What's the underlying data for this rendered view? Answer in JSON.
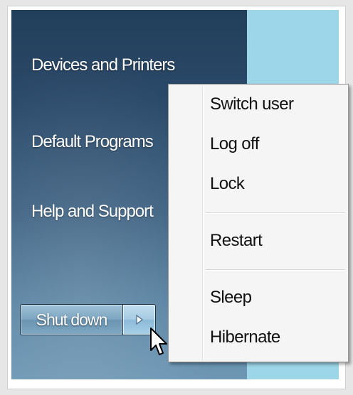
{
  "start_menu": {
    "right_pane": {
      "items": [
        {
          "label": "Devices and Printers"
        },
        {
          "label": "Default Programs"
        },
        {
          "label": "Help and Support"
        }
      ]
    },
    "shutdown": {
      "label": "Shut down",
      "arrow_icon": "triangle-right-icon"
    }
  },
  "power_menu": {
    "groups": [
      [
        {
          "label": "Switch user"
        },
        {
          "label": "Log off"
        },
        {
          "label": "Lock"
        }
      ],
      [
        {
          "label": "Restart"
        }
      ],
      [
        {
          "label": "Sleep"
        },
        {
          "label": "Hibernate"
        }
      ]
    ]
  },
  "colors": {
    "panel_top": "#223e5a",
    "panel_bottom": "#6e97b4",
    "desktop": "#9dd6e8",
    "menu_background": "#f5f5f5",
    "menu_text": "#111111"
  }
}
